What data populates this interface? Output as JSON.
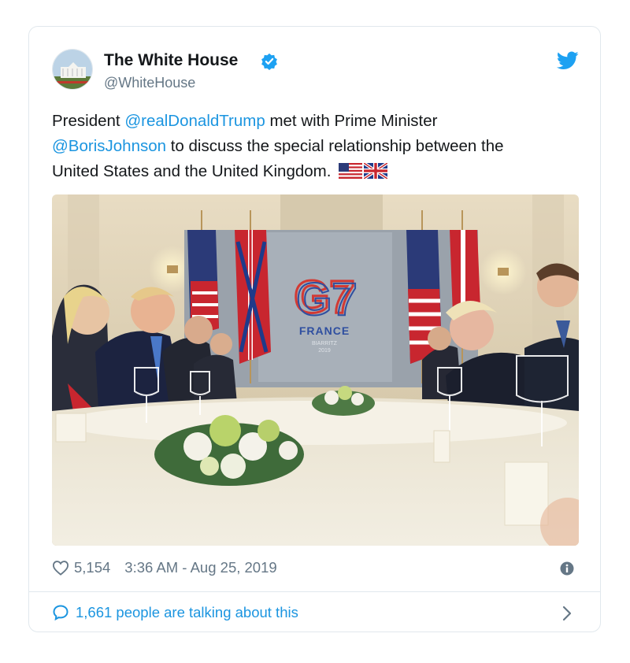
{
  "tweet": {
    "author_name": "The White House",
    "author_handle": "@WhiteHouse",
    "text": {
      "line1_prefix": "President ",
      "mention1": "@realDonaldTrump",
      "line1_suffix": " met with Prime Minister",
      "mention2": "@BorisJohnson",
      "line2_suffix": " to discuss the special relationship between the",
      "line3": "United States and the United Kingdom. "
    },
    "flags": [
      "us-flag",
      "uk-flag"
    ],
    "photo": {
      "backdrop_logo": "G7",
      "backdrop_country": "FRANCE",
      "backdrop_city": "BIARRITZ",
      "backdrop_year": "2019"
    },
    "likes": "5,154",
    "timestamp": "3:36 AM - Aug 25, 2019",
    "talking": "1,661 people are talking about this"
  },
  "colors": {
    "link": "#1b95e0",
    "muted": "#657786",
    "border": "#e1e8ed"
  },
  "icons": [
    "verified-badge-icon",
    "twitter-bird-icon",
    "heart-icon",
    "info-icon",
    "comment-icon",
    "chevron-right-icon"
  ]
}
